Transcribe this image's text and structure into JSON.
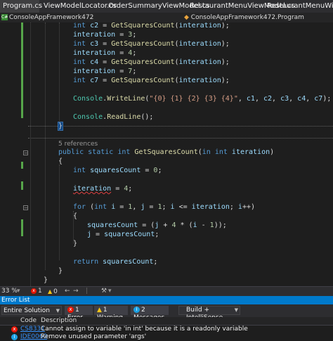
{
  "tabs": [
    {
      "label": "Program.cs",
      "active": true
    },
    {
      "label": "ViewModelLocator.cs",
      "active": false
    },
    {
      "label": "OrderSummaryViewModel.cs",
      "active": false
    },
    {
      "label": "RestaurantMenuViewModel.cs",
      "active": false
    },
    {
      "label": "RestaurantMenuWindow.xa",
      "active": false
    }
  ],
  "navbar": {
    "project": "ConsoleAppFramework472",
    "class": "ConsoleAppFramework472.Program"
  },
  "editor": {
    "references_label": "5 references",
    "zoom": "33 %",
    "errors": "1",
    "warnings": "0"
  },
  "error_list": {
    "title": "Error List",
    "scope": "Entire Solution",
    "errors_filter": "1 Error",
    "warnings_filter": "1 Warning",
    "messages_filter": "2 Messages",
    "build_filter": "Build + IntelliSense",
    "columns": {
      "code": "Code",
      "description": "Description"
    },
    "rows": [
      {
        "code": "CS8331",
        "description": "Cannot assign to variable 'in int' because it is a readonly variable"
      },
      {
        "code": "IDE0060",
        "description": "Remove unused parameter 'args'"
      }
    ]
  },
  "colors": {
    "keyword": "#569cd6",
    "identifier": "#9cdcfe",
    "method": "#dcdcaa",
    "type": "#4ec9b0",
    "number": "#b5cea8",
    "string": "#d69d85",
    "accent": "#007acc"
  }
}
